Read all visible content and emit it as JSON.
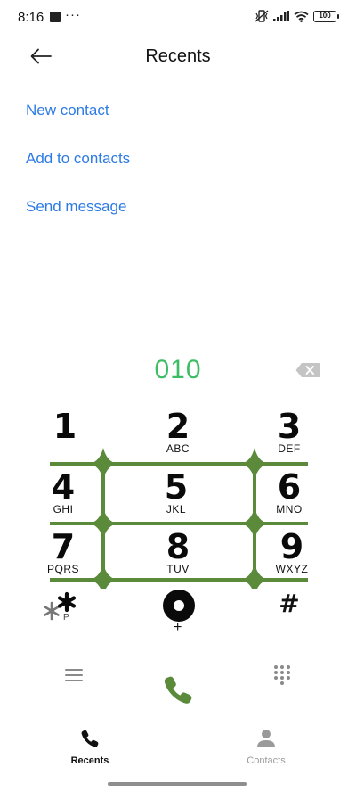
{
  "status_bar": {
    "time": "8:16",
    "battery": "100"
  },
  "header": {
    "title": "Recents"
  },
  "actions": [
    {
      "label": "New contact"
    },
    {
      "label": "Add to contacts"
    },
    {
      "label": "Send message"
    }
  ],
  "dialer": {
    "number": "010",
    "number_color": "#3cbd63",
    "pad_color": "#5a8a3a"
  },
  "keys": [
    {
      "digit": "1",
      "letters": ""
    },
    {
      "digit": "2",
      "letters": "ABC"
    },
    {
      "digit": "3",
      "letters": "DEF"
    },
    {
      "digit": "4",
      "letters": "GHI"
    },
    {
      "digit": "5",
      "letters": "JKL"
    },
    {
      "digit": "6",
      "letters": "MNO"
    },
    {
      "digit": "7",
      "letters": "PQRS"
    },
    {
      "digit": "8",
      "letters": "TUV"
    },
    {
      "digit": "9",
      "letters": "WXYZ"
    }
  ],
  "special_keys": {
    "star_sub": "P",
    "zero_sub": "+",
    "hash": "#"
  },
  "call_color": "#5a8a3a",
  "bottom_nav": [
    {
      "label": "Recents",
      "icon": "phone-icon",
      "active": true
    },
    {
      "label": "Contacts",
      "icon": "person-icon",
      "active": false
    }
  ]
}
